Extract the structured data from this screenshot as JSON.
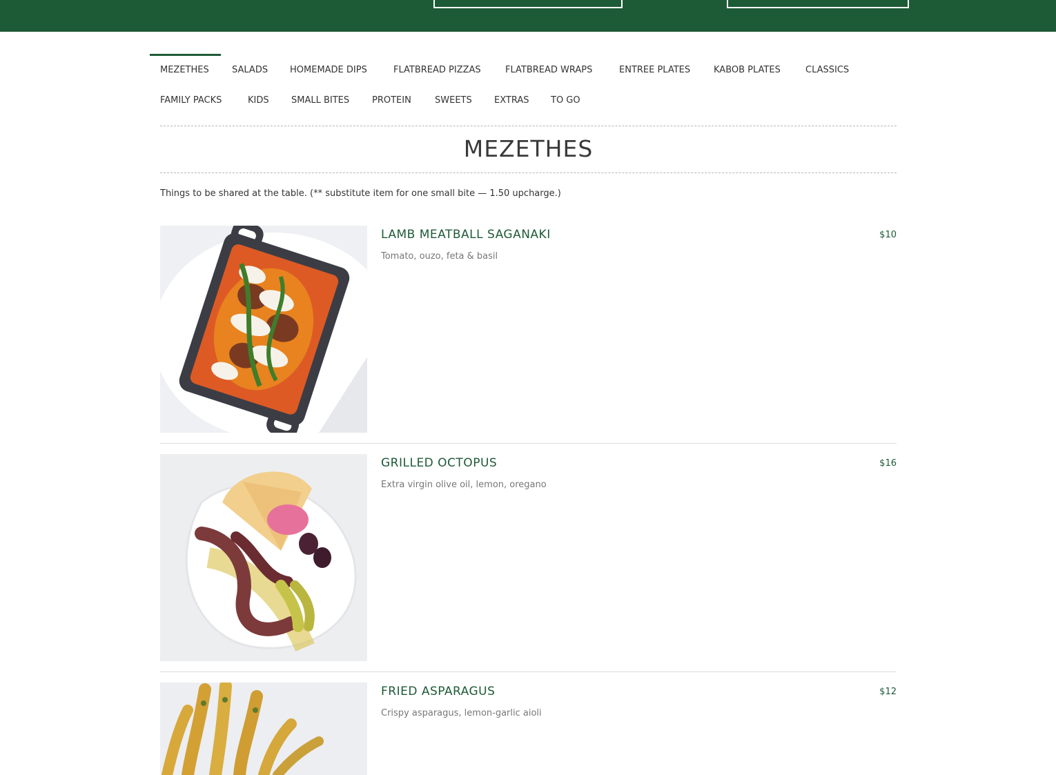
{
  "colors": {
    "brand_green": "#1d5a36",
    "text": "#333333",
    "muted": "#777777"
  },
  "nav": {
    "tabs": [
      {
        "label": "MEZETHES",
        "active": true
      },
      {
        "label": "SALADS"
      },
      {
        "label": "HOMEMADE DIPS"
      },
      {
        "label": "FLATBREAD PIZZAS"
      },
      {
        "label": "FLATBREAD WRAPS"
      },
      {
        "label": "ENTREE PLATES"
      },
      {
        "label": "KABOB PLATES"
      },
      {
        "label": "CLASSICS"
      },
      {
        "label": "FAMILY PACKS"
      },
      {
        "label": "KIDS"
      },
      {
        "label": "SMALL BITES"
      },
      {
        "label": "PROTEIN"
      },
      {
        "label": "SWEETS"
      },
      {
        "label": "EXTRAS"
      },
      {
        "label": "TO GO"
      }
    ]
  },
  "section": {
    "title": "MEZETHES",
    "description": "Things to be shared at the table. (** substitute item for one small bite — 1.50 upcharge.)"
  },
  "items": [
    {
      "name": "LAMB MEATBALL SAGANAKI",
      "price": "$10",
      "description": "Tomato, ouzo, feta & basil",
      "image_icon": "lamb-meatball-saganaki-photo"
    },
    {
      "name": "GRILLED OCTOPUS",
      "price": "$16",
      "description": "Extra virgin olive oil, lemon, oregano",
      "image_icon": "grilled-octopus-photo"
    },
    {
      "name": "FRIED ASPARAGUS",
      "price": "$12",
      "description": "Crispy asparagus, lemon-garlic aioli",
      "image_icon": "fried-asparagus-photo"
    }
  ]
}
